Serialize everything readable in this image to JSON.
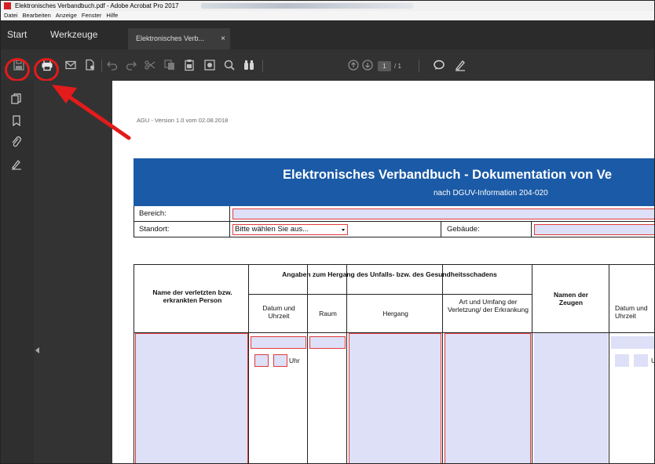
{
  "window": {
    "title": "Elektronisches Verbandbuch.pdf - Adobe Acrobat Pro 2017",
    "menu": [
      "Datei",
      "Bearbeiten",
      "Anzeige",
      "Fenster",
      "Hilfe"
    ]
  },
  "tabs": {
    "start": "Start",
    "tools": "Werkzeuge",
    "document": "Elektronisches Verb...",
    "close": "×"
  },
  "toolbar": {
    "page_current": "1",
    "page_total": "/ 1"
  },
  "icons": {
    "save": "save-icon",
    "print": "print-icon",
    "email": "mail-icon",
    "search_doc": "document-search-icon",
    "undo": "undo-icon",
    "redo": "redo-icon",
    "cut": "scissors-icon",
    "copy": "copy-icon",
    "paste": "clipboard-icon",
    "snapshot": "camera-icon",
    "find": "search-icon",
    "binoculars": "binoculars-icon",
    "prev": "arrow-up-circle-icon",
    "next": "arrow-down-circle-icon",
    "comment": "comment-icon",
    "sign": "pen-icon"
  },
  "colors": {
    "banner": "#1b5aa6",
    "field_fill": "#dde0f7",
    "field_border": "#e23a3a",
    "highlight": "#e31b1b"
  },
  "doc": {
    "version": "AGU - Version 1.0 vom 02.08.2018",
    "title": "Elektronisches Verbandbuch - Dokumentation von Ve",
    "subtitle": "nach DGUV-Information 204-020",
    "bereich_label": "Bereich:",
    "standort_label": "Standort:",
    "standort_select": "Bitte wählen Sie aus...",
    "gebaeude_label": "Gebäude:",
    "table": {
      "col_name": "Name der verletzten bzw. erkrankten Person",
      "group_header": "Angaben zum Hergang des Unfalls- bzw. des Gesundheitsschadens",
      "col_datum": "Datum und Uhrzeit",
      "col_raum": "Raum",
      "col_hergang": "Hergang",
      "col_art": "Art und Umfang der Verletzung/ der Erkrankung",
      "col_zeugen": "Namen der Zeugen",
      "col_datum2": "Datum und Uhrzeit",
      "uhr": "Uhr",
      "uhr_partial": "U"
    }
  }
}
